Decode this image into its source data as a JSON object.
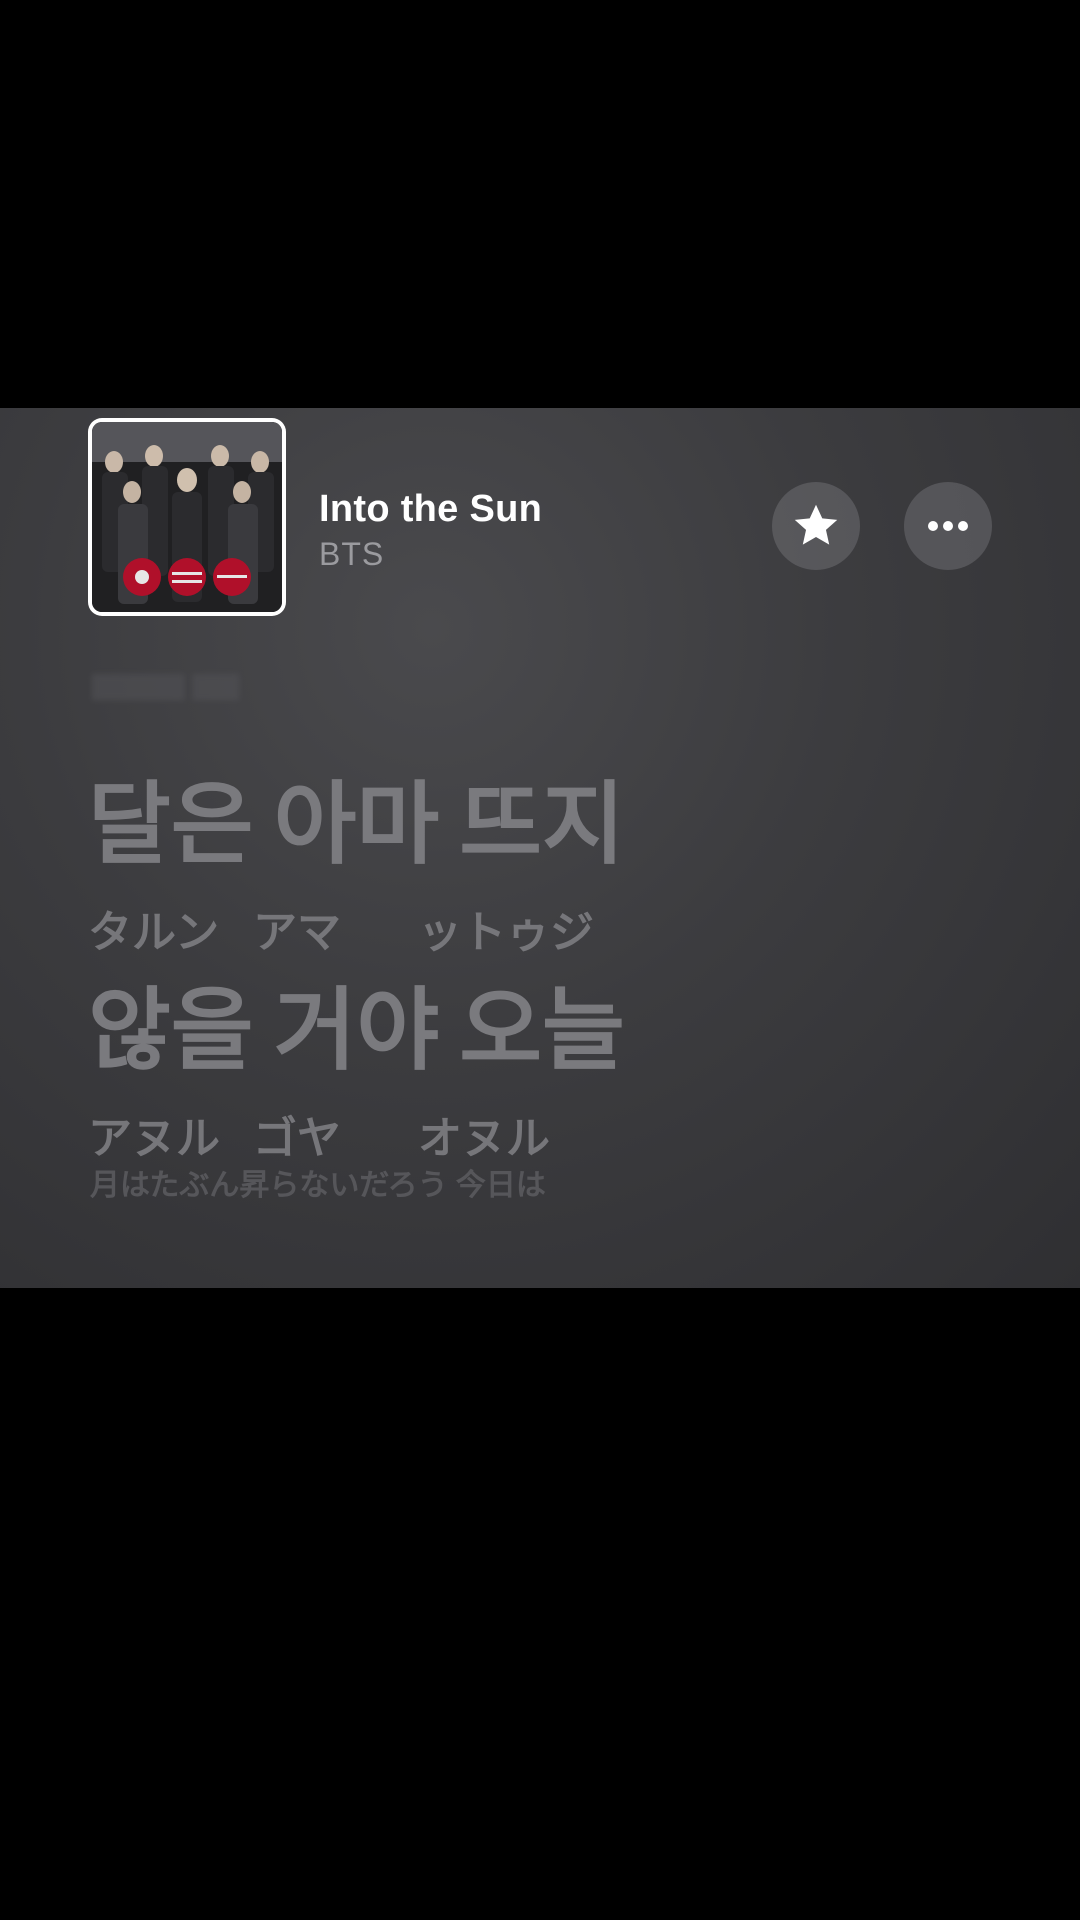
{
  "now_playing": {
    "title": "Into the Sun",
    "artist": "BTS",
    "artwork_icon": "album-artwork-image"
  },
  "actions": {
    "favorite_icon": "star-icon",
    "more_icon": "ellipsis-icon"
  },
  "lyrics": {
    "line1": {
      "words": [
        "달은",
        "아마",
        "뜨지"
      ],
      "reading": [
        "タルン",
        "アマ",
        "ットゥジ"
      ]
    },
    "line2": {
      "words": [
        "않을",
        "거야",
        "오늘"
      ],
      "reading": [
        "アヌル",
        "ゴヤ",
        "オヌル"
      ]
    },
    "translation": "月はたぶん昇らないだろう 今日は"
  },
  "colors": {
    "background": "#000000",
    "player_bg": "#3c3c3f",
    "title": "#ffffff",
    "artist": "#9b9b9f",
    "lyric": "#7a7a7e"
  }
}
